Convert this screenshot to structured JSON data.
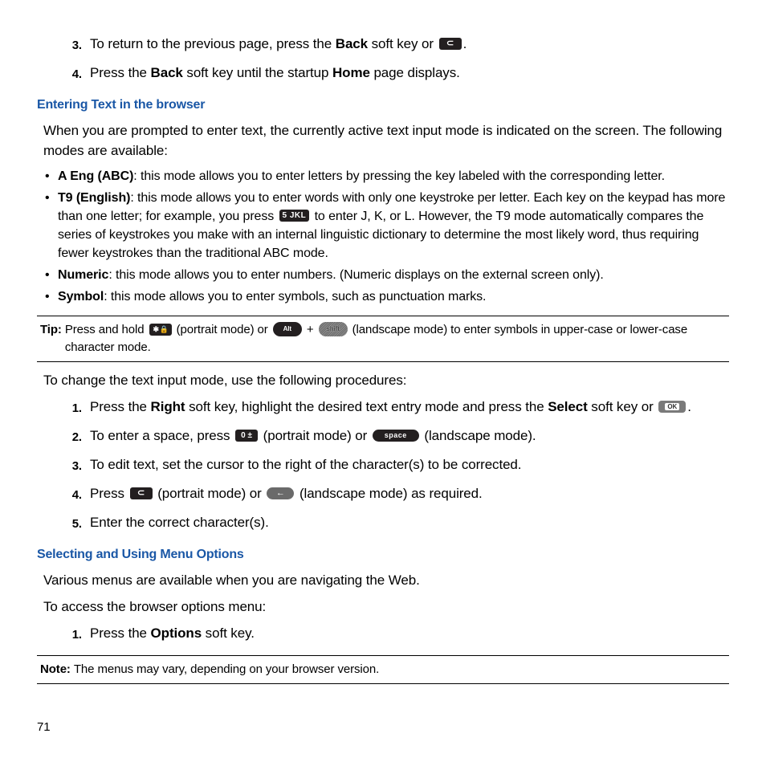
{
  "steps_top": [
    {
      "num": "3.",
      "pre": "To return to the previous page, press the ",
      "bold1": "Back",
      "mid": " soft key or ",
      "icon": "c",
      "post": "."
    },
    {
      "num": "4.",
      "pre": "Press the ",
      "bold1": "Back",
      "mid": " soft key until the startup ",
      "bold2": "Home",
      "post": " page displays."
    }
  ],
  "section1": "Entering Text in the browser",
  "para1": "When you are prompted to enter text, the currently active text input mode is indicated on the screen. The following modes are available:",
  "bullets": [
    {
      "lead": "A Eng (ABC)",
      "text": ": this mode allows you to enter letters by pressing the key labeled with the corresponding letter."
    },
    {
      "lead": "T9 (English)",
      "text_a": ": this mode allows you to enter words with only one keystroke per letter. Each key on the keypad has more than one letter; for example, you press ",
      "icon": "5jkl",
      "text_b": " to enter J, K, or L. However, the T9 mode automatically compares the series of keystrokes you make with an internal linguistic dictionary to determine the most likely word, thus requiring fewer keystrokes than the traditional ABC mode."
    },
    {
      "lead": "Numeric",
      "text": ": this mode allows you to enter numbers. (Numeric displays on the external screen only)."
    },
    {
      "lead": "Symbol",
      "text": ": this mode allows you to enter symbols, such as punctuation marks."
    }
  ],
  "tip": {
    "lead": "Tip:",
    "a": "Press and hold ",
    "b": " (portrait mode) or ",
    "plus": " + ",
    "c": " (landscape mode) to enter symbols in upper-case or lower-case character mode."
  },
  "para2": "To change the text input mode, use the following procedures:",
  "steps2": [
    {
      "num": "1.",
      "a": "Press the ",
      "b1": "Right",
      "b": " soft key, highlight the desired text entry mode and press the ",
      "b2": "Select",
      "c": " soft key or ",
      "icon": "ok",
      "d": "."
    },
    {
      "num": "2.",
      "a": "To enter a space, press ",
      "icon1": "0pm",
      "b": " (portrait mode) or ",
      "icon2": "space",
      "c": " (landscape mode)."
    },
    {
      "num": "3.",
      "a": "To edit text, set the cursor to the right of the character(s) to be corrected."
    },
    {
      "num": "4.",
      "a": "Press ",
      "icon1": "c",
      "b": " (portrait mode) or ",
      "icon2": "backarrow",
      "c": " (landscape mode) as required."
    },
    {
      "num": "5.",
      "a": "Enter the correct character(s)."
    }
  ],
  "section2": "Selecting and Using Menu Options",
  "para3": "Various menus are available when you are navigating the Web.",
  "para4": "To access the browser options menu:",
  "steps3": [
    {
      "num": "1.",
      "a": "Press the ",
      "b1": "Options",
      "b": " soft key."
    }
  ],
  "note": {
    "lead": "Note:",
    "text": "The menus may vary, depending on your browser version."
  },
  "page_num": "71"
}
